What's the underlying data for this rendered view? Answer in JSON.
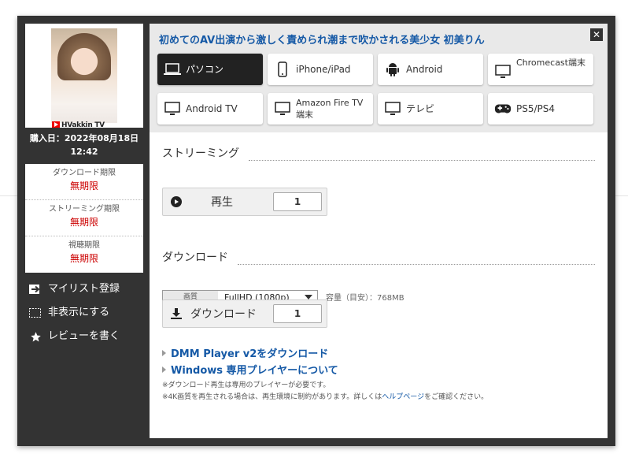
{
  "title": "初めてのAV出演から激しく責められ潮まで吹かされる美少女 初美りん",
  "thumbnail": {
    "logo": "HVakkin TV"
  },
  "purchase": {
    "line1": "購入日：2022年08月18日",
    "line2": "12:42"
  },
  "limits": [
    {
      "label": "ダウンロード期限",
      "value": "無期限"
    },
    {
      "label": "ストリーミング期限",
      "value": "無期限"
    },
    {
      "label": "視聴期限",
      "value": "無期限"
    }
  ],
  "actions": [
    {
      "label": "マイリスト登録",
      "icon": "mylist-icon"
    },
    {
      "label": "非表示にする",
      "icon": "hide-icon"
    },
    {
      "label": "レビューを書く",
      "icon": "star-icon"
    }
  ],
  "devices": [
    {
      "label": "パソコン",
      "icon": "laptop-icon",
      "active": true
    },
    {
      "label": "iPhone/iPad",
      "icon": "phone-icon",
      "active": false
    },
    {
      "label": "Android",
      "icon": "android-icon",
      "active": false
    },
    {
      "label": "Chromecast端末",
      "icon": "monitor-icon",
      "active": false
    },
    {
      "label": "Android TV",
      "icon": "monitor-icon",
      "active": false
    },
    {
      "label": "Amazon Fire TV 端末",
      "icon": "monitor-icon",
      "active": false
    },
    {
      "label": "テレビ",
      "icon": "monitor-icon",
      "active": false
    },
    {
      "label": "PS5/PS4",
      "icon": "gamepad-icon",
      "active": false
    }
  ],
  "streaming": {
    "section_title": "ストリーミング",
    "play_label": "再生",
    "count": "1"
  },
  "download": {
    "section_title": "ダウンロード",
    "quality_label": "画質",
    "quality_value": "FullHD (1080p)",
    "capacity": "容量（目安）：768MB",
    "download_label": "ダウンロード",
    "count": "1"
  },
  "links": [
    "DMM Player v2をダウンロード",
    "Windows 専用プレイヤーについて"
  ],
  "notes": {
    "note1": "※ダウンロード再生は専用のプレイヤーが必要です。",
    "note2_pre": "※4K画質を再生される場合は、再生環境に制約があります。詳しくは",
    "note2_link": "ヘルプページ",
    "note2_post": "をご確認ください。"
  },
  "colors": {
    "link_blue": "#1559a6",
    "limit_red": "#cc0000",
    "modal_dark": "#333333"
  }
}
